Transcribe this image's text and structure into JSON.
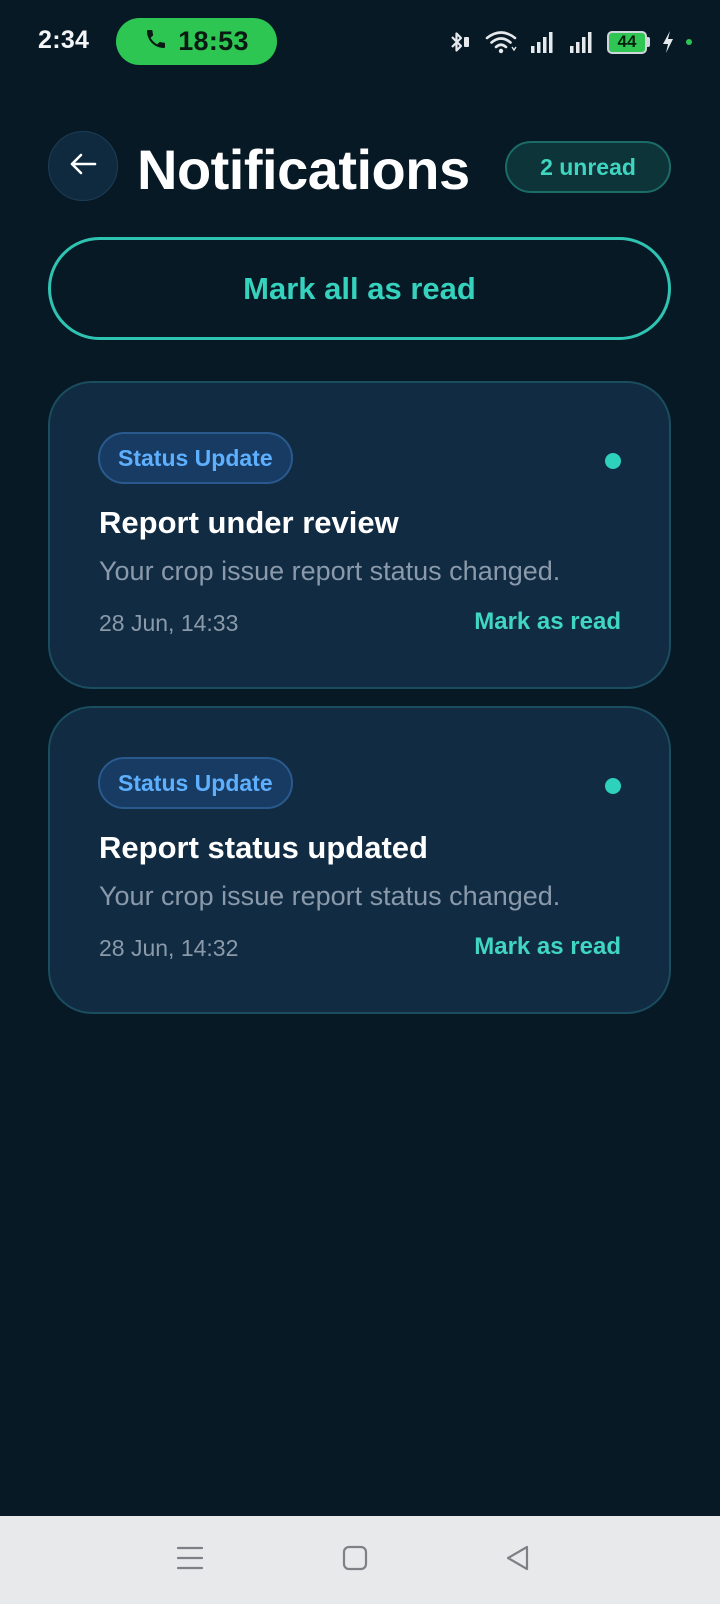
{
  "status_bar": {
    "time": "2:34",
    "call_duration": "18:53",
    "battery_level": "44",
    "icons": [
      "bluetooth-icon",
      "wifi-icon",
      "signal-icon",
      "signal-icon",
      "battery-icon",
      "charging-icon"
    ]
  },
  "header": {
    "back_icon": "arrow-left-icon",
    "title": "Notifications",
    "unread_badge": "2 unread"
  },
  "mark_all_label": "Mark all as read",
  "notifications": [
    {
      "tag": "Status Update",
      "title": "Report under review",
      "body": "Your crop issue report status changed.",
      "time": "28 Jun, 14:33",
      "action": "Mark as read",
      "unread": true
    },
    {
      "tag": "Status Update",
      "title": "Report status updated",
      "body": "Your crop issue report status changed.",
      "time": "28 Jun, 14:32",
      "action": "Mark as read",
      "unread": true
    }
  ],
  "nav_bar": {
    "icons": [
      "menu-icon",
      "home-icon",
      "back-triangle-icon"
    ]
  },
  "colors": {
    "background": "#081926",
    "card": "#112b43",
    "accent_teal": "#35d2bd",
    "tag_blue": "#5eb0ff",
    "call_green": "#2dc653"
  }
}
